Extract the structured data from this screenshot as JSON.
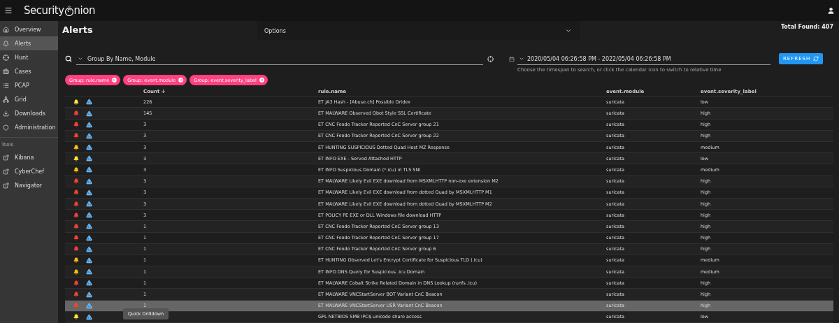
{
  "header": {
    "brand_left": "Security",
    "brand_right": "nion"
  },
  "sidebar": {
    "items": [
      {
        "label": "Overview",
        "selected": false
      },
      {
        "label": "Alerts",
        "selected": true
      },
      {
        "label": "Hunt",
        "selected": false
      },
      {
        "label": "Cases",
        "selected": false
      },
      {
        "label": "PCAP",
        "selected": false
      },
      {
        "label": "Grid",
        "selected": false
      },
      {
        "label": "Downloads",
        "selected": false
      },
      {
        "label": "Administration",
        "selected": false
      }
    ],
    "tools_heading": "Tools",
    "tools": [
      {
        "label": "Kibana"
      },
      {
        "label": "CyberChef"
      },
      {
        "label": "Navigator"
      }
    ]
  },
  "page": {
    "title": "Alerts",
    "options_label": "Options",
    "total_found": "Total Found: 407"
  },
  "query": {
    "value": "Group By Name, Module"
  },
  "timespan": {
    "value": "2020/05/04 06:26:58 PM - 2022/05/04 06:26:58 PM",
    "hint": "Choose the timespan to search, or click the calendar icon to switch to relative time"
  },
  "refresh_button": "REFRESH",
  "chips": [
    "Group: rule.name",
    "Group: event.module",
    "Group: event.severity_label"
  ],
  "table": {
    "columns": [
      "Count",
      "rule.name",
      "event.module",
      "event.severity_label"
    ],
    "rows": [
      {
        "count": "226",
        "rule": "ET JA3 Hash - [Abuse.ch] Possible Dridex",
        "module": "suricata",
        "severity": "low",
        "color": "#ffeb3b",
        "selected": false
      },
      {
        "count": "145",
        "rule": "ET MALWARE Observed Qbot Style SSL Certificate",
        "module": "suricata",
        "severity": "high",
        "color": "#f44336",
        "selected": false
      },
      {
        "count": "3",
        "rule": "ET CNC Feodo Tracker Reported CnC Server group 21",
        "module": "suricata",
        "severity": "high",
        "color": "#f44336",
        "selected": false
      },
      {
        "count": "3",
        "rule": "ET CNC Feodo Tracker Reported CnC Server group 22",
        "module": "suricata",
        "severity": "high",
        "color": "#f44336",
        "selected": false
      },
      {
        "count": "3",
        "rule": "ET HUNTING SUSPICIOUS Dotted Quad Host MZ Response",
        "module": "suricata",
        "severity": "medium",
        "color": "#ffc107",
        "selected": false
      },
      {
        "count": "3",
        "rule": "ET INFO EXE - Served Attached HTTP",
        "module": "suricata",
        "severity": "low",
        "color": "#ffeb3b",
        "selected": false
      },
      {
        "count": "3",
        "rule": "ET INFO Suspicious Domain (*.icu) in TLS SNI",
        "module": "suricata",
        "severity": "medium",
        "color": "#ffc107",
        "selected": false
      },
      {
        "count": "3",
        "rule": "ET MALWARE Likely Evil EXE download from MSXMLHTTP non-exe extension M2",
        "module": "suricata",
        "severity": "high",
        "color": "#f44336",
        "selected": false
      },
      {
        "count": "3",
        "rule": "ET MALWARE Likely Evil EXE download from dotted Quad by MSXMLHTTP M1",
        "module": "suricata",
        "severity": "high",
        "color": "#f44336",
        "selected": false
      },
      {
        "count": "3",
        "rule": "ET MALWARE Likely Evil EXE download from dotted Quad by MSXMLHTTP M2",
        "module": "suricata",
        "severity": "high",
        "color": "#f44336",
        "selected": false
      },
      {
        "count": "3",
        "rule": "ET POLICY PE EXE or DLL Windows file download HTTP",
        "module": "suricata",
        "severity": "high",
        "color": "#f44336",
        "selected": false
      },
      {
        "count": "1",
        "rule": "ET CNC Feodo Tracker Reported CnC Server group 13",
        "module": "suricata",
        "severity": "high",
        "color": "#f44336",
        "selected": false
      },
      {
        "count": "1",
        "rule": "ET CNC Feodo Tracker Reported CnC Server group 17",
        "module": "suricata",
        "severity": "high",
        "color": "#f44336",
        "selected": false
      },
      {
        "count": "1",
        "rule": "ET CNC Feodo Tracker Reported CnC Server group 6",
        "module": "suricata",
        "severity": "high",
        "color": "#f44336",
        "selected": false
      },
      {
        "count": "1",
        "rule": "ET HUNTING Observed Let's Encrypt Certificate for Suspicious TLD (.icu)",
        "module": "suricata",
        "severity": "medium",
        "color": "#ffc107",
        "selected": false
      },
      {
        "count": "1",
        "rule": "ET INFO DNS Query for Suspicious .icu Domain",
        "module": "suricata",
        "severity": "medium",
        "color": "#ffc107",
        "selected": false
      },
      {
        "count": "1",
        "rule": "ET MALWARE Cobalt Strike Related Domain in DNS Lookup (runfs .icu)",
        "module": "suricata",
        "severity": "high",
        "color": "#f44336",
        "selected": false
      },
      {
        "count": "1",
        "rule": "ET MALWARE VNCStartServer BOT Variant CnC Beacon",
        "module": "suricata",
        "severity": "high",
        "color": "#f44336",
        "selected": false
      },
      {
        "count": "1",
        "rule": "ET MALWARE VNCStartServer USR Variant CnC Beacon",
        "module": "suricata",
        "severity": "high",
        "color": "#f44336",
        "selected": true
      },
      {
        "rule": "GPL NETBIOS SMB IPC$ unicode share access",
        "module": "suricata",
        "severity": "low",
        "color": "#ffeb3b",
        "selected": false,
        "tooltip": "Quick Drilldown"
      }
    ]
  }
}
